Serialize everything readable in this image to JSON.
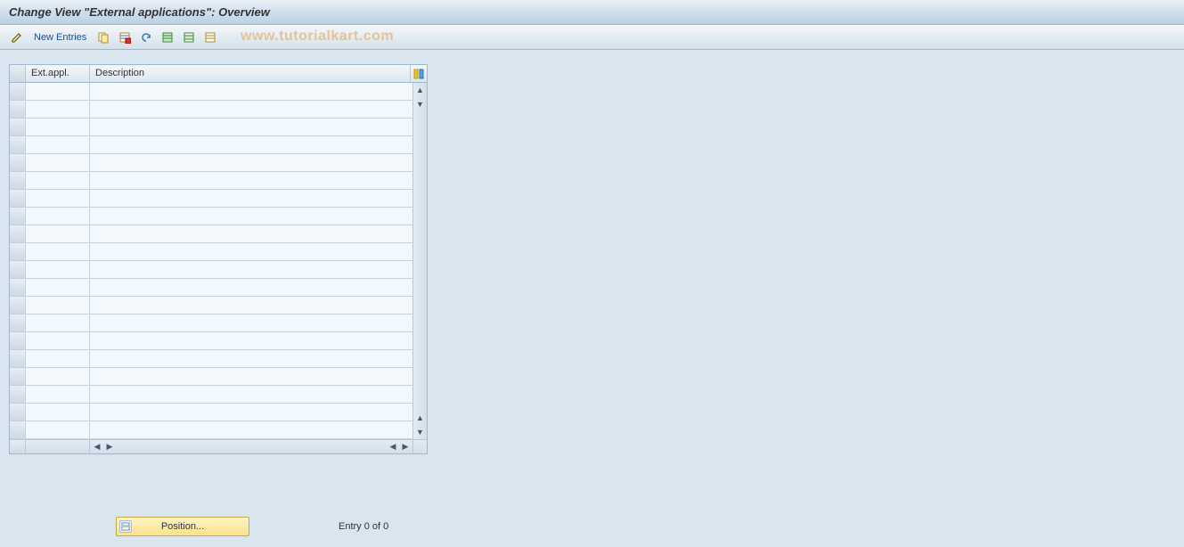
{
  "header": {
    "title": "Change View \"External applications\": Overview"
  },
  "toolbar": {
    "new_entries_label": "New Entries"
  },
  "watermark": {
    "text": "www.tutorialkart.com"
  },
  "table": {
    "columns": {
      "ext_appl": "Ext.appl.",
      "description": "Description"
    },
    "row_count": 20
  },
  "footer": {
    "position_label": "Position...",
    "entry_text": "Entry 0 of 0"
  }
}
